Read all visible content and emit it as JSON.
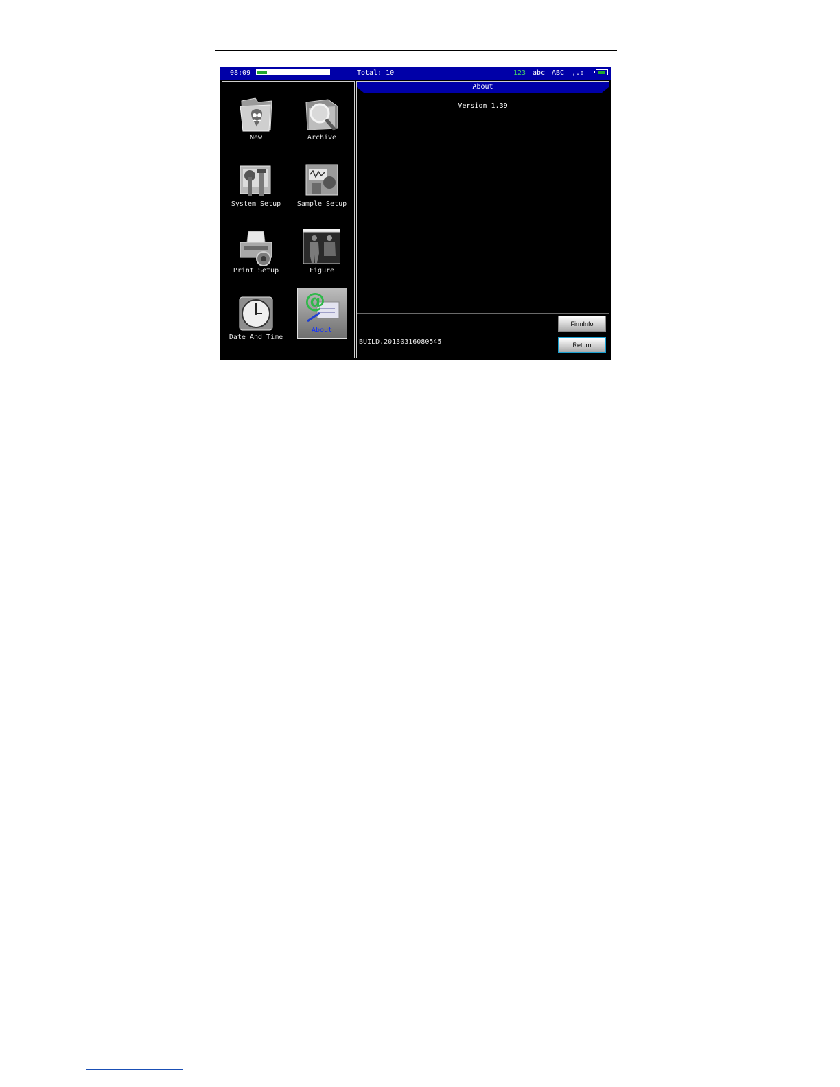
{
  "status_bar": {
    "time": "08:09",
    "progress_fraction": 0.13,
    "total": "Total: 10",
    "mode_123": "123",
    "mode_abc": "abc",
    "mode_ABC": "ABC",
    "mode_punct": ",.:",
    "battery_fraction": 0.8
  },
  "menu": {
    "items": [
      {
        "label": "New"
      },
      {
        "label": "Archive"
      },
      {
        "label": "System Setup"
      },
      {
        "label": "Sample Setup"
      },
      {
        "label": "Print Setup"
      },
      {
        "label": "Figure"
      },
      {
        "label": "Date And Time"
      },
      {
        "label": "About"
      }
    ]
  },
  "about_panel": {
    "title": "About",
    "version": "Version 1.39",
    "build": "BUILD.20130316080545",
    "firminfo_label": "FirmInfo",
    "return_label": "Return"
  },
  "colors": {
    "bar_blue": "#0000a8",
    "selected_text": "#1030ff",
    "indicator_green": "#22a830"
  }
}
